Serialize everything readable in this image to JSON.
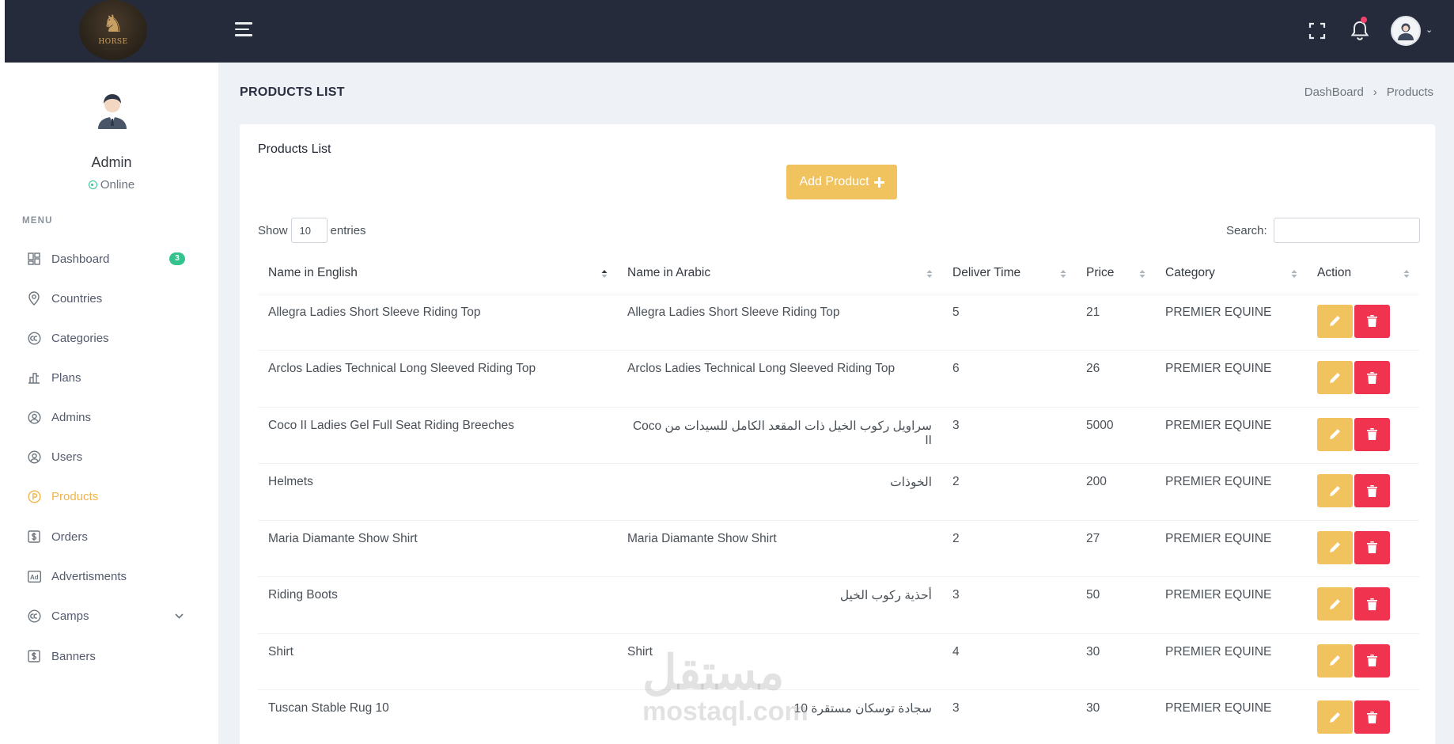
{
  "logo": {
    "brand_text": "HORSE"
  },
  "sidebar": {
    "user": {
      "name": "Admin",
      "status": "Online"
    },
    "menu_title": "MENU",
    "items": [
      {
        "label": "Dashboard",
        "icon": "dashboard-icon",
        "badge": "3"
      },
      {
        "label": "Countries",
        "icon": "map-pin-icon"
      },
      {
        "label": "Categories",
        "icon": "copyright-icon"
      },
      {
        "label": "Plans",
        "icon": "chart-icon"
      },
      {
        "label": "Admins",
        "icon": "user-circle-icon"
      },
      {
        "label": "Users",
        "icon": "user-circle-icon"
      },
      {
        "label": "Products",
        "icon": "product-icon",
        "active": true
      },
      {
        "label": "Orders",
        "icon": "dollar-square-icon"
      },
      {
        "label": "Advertisments",
        "icon": "ad-icon"
      },
      {
        "label": "Camps",
        "icon": "copyright-icon",
        "has_submenu": true
      },
      {
        "label": "Banners",
        "icon": "dollar-square-icon"
      }
    ]
  },
  "header": {
    "page_title": "PRODUCTS LIST",
    "breadcrumb": [
      "DashBoard",
      "Products"
    ]
  },
  "card": {
    "title": "Products List",
    "add_button_label": "Add Product",
    "show_label": "Show",
    "entries_value": "10",
    "entries_label": "entries",
    "search_label": "Search:",
    "search_value": ""
  },
  "table": {
    "columns": [
      "Name in English",
      "Name in Arabic",
      "Deliver Time",
      "Price",
      "Category",
      "Action"
    ],
    "rows": [
      {
        "name_en": "Allegra Ladies Short Sleeve Riding Top",
        "name_ar": "Allegra Ladies Short Sleeve Riding Top",
        "deliver_time": "5",
        "price": "21",
        "category": "PREMIER EQUINE"
      },
      {
        "name_en": "Arclos Ladies Technical Long Sleeved Riding Top",
        "name_ar": "Arclos Ladies Technical Long Sleeved Riding Top",
        "deliver_time": "6",
        "price": "26",
        "category": "PREMIER EQUINE"
      },
      {
        "name_en": "Coco II Ladies Gel Full Seat Riding Breeches",
        "name_ar": "سراويل ركوب الخيل ذات المقعد الكامل للسيدات من Coco II",
        "deliver_time": "3",
        "price": "5000",
        "category": "PREMIER EQUINE"
      },
      {
        "name_en": "Helmets",
        "name_ar": "الخوذات",
        "deliver_time": "2",
        "price": "200",
        "category": "PREMIER EQUINE"
      },
      {
        "name_en": "Maria Diamante Show Shirt",
        "name_ar": "Maria Diamante Show Shirt",
        "deliver_time": "2",
        "price": "27",
        "category": "PREMIER EQUINE"
      },
      {
        "name_en": "Riding Boots",
        "name_ar": "أحذية ركوب الخيل",
        "deliver_time": "3",
        "price": "50",
        "category": "PREMIER EQUINE"
      },
      {
        "name_en": "Shirt",
        "name_ar": "Shirt",
        "deliver_time": "4",
        "price": "30",
        "category": "PREMIER EQUINE"
      },
      {
        "name_en": "Tuscan Stable Rug 10",
        "name_ar": "سجادة توسكان مستقرة 10",
        "deliver_time": "3",
        "price": "30",
        "category": "PREMIER EQUINE"
      }
    ]
  },
  "watermark": {
    "line1": "مستقل",
    "line2": "mostaql.com"
  },
  "colors": {
    "topbar": "#252b3b",
    "accent_yellow": "#f1c35f",
    "danger_red": "#f0334f",
    "active_menu": "#f1b44c",
    "success_green": "#34c38f"
  }
}
